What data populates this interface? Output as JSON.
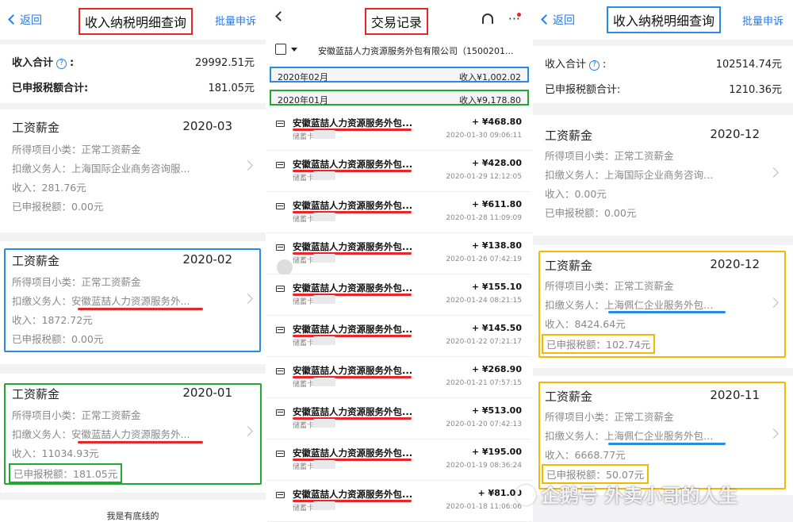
{
  "colors": {
    "accent": "#2a7ae2",
    "red_highlight": "#e8262a",
    "blue_highlight": "#2a8ae2",
    "green_highlight": "#22a832",
    "yellow_highlight": "#f5b800"
  },
  "left": {
    "nav": {
      "back": "返回",
      "title": "收入纳税明细查询",
      "right": "批量申诉"
    },
    "summary": {
      "income_label": "收入合计",
      "income_value": "29992.51元",
      "tax_label": "已申报税额合计:",
      "tax_value": "181.05元",
      "colon": ":"
    },
    "cards": [
      {
        "title": "工资薪金",
        "date": "2020-03",
        "subtype": "所得项目小类：正常工资薪金",
        "withholder": "扣缴义务人：上海国际企业商务咨询服...",
        "income": "收入：281.76元",
        "tax": "已申报税额：0.00元"
      },
      {
        "title": "工资薪金",
        "date": "2020-02",
        "subtype": "所得项目小类：正常工资薪金",
        "withholder_label": "扣缴义务人：",
        "withholder": "安徽蓝喆人力资源服务外...",
        "income": "收入：1872.72元",
        "tax": "已申报税额：0.00元"
      },
      {
        "title": "工资薪金",
        "date": "2020-01",
        "subtype": "所得项目小类：正常工资薪金",
        "withholder_label": "扣缴义务人：",
        "withholder": "安徽蓝喆人力资源服务外...",
        "income": "收入：11034.93元",
        "tax": "已申报税额：181.05元"
      }
    ],
    "footer": "我是有底线的"
  },
  "middle": {
    "nav": {
      "title": "交易记录"
    },
    "filter": {
      "merchant": "安徽蓝喆人力资源服务外包有限公司（1500201..."
    },
    "months": [
      {
        "month": "2020年02月",
        "summary": "收入¥1,002.02"
      },
      {
        "month": "2020年01月",
        "summary": "收入¥9,178.80"
      }
    ],
    "transactions": [
      {
        "name": "安徽蓝喆人力资源服务外包...",
        "card": "储蓄卡",
        "amount": "+ ¥468.80",
        "time": "2020-01-30 09:06:11"
      },
      {
        "name": "安徽蓝喆人力资源服务外包...",
        "card": "储蓄卡",
        "amount": "+ ¥428.00",
        "time": "2020-01-29 12:12:05"
      },
      {
        "name": "安徽蓝喆人力资源服务外包...",
        "card": "储蓄卡",
        "amount": "+ ¥611.80",
        "time": "2020-01-28 11:09:09"
      },
      {
        "name": "安徽蓝喆人力资源服务外包...",
        "card": "储蓄卡",
        "amount": "+ ¥138.80",
        "time": "2020-01-26 07:42:19"
      },
      {
        "name": "安徽蓝喆人力资源服务外包...",
        "card": "储蓄卡",
        "amount": "+ ¥155.10",
        "time": "2020-01-24 08:21:15"
      },
      {
        "name": "安徽蓝喆人力资源服务外包...",
        "card": "储蓄卡",
        "amount": "+ ¥145.50",
        "time": "2020-01-22 07:21:17"
      },
      {
        "name": "安徽蓝喆人力资源服务外包...",
        "card": "储蓄卡",
        "amount": "+ ¥268.90",
        "time": "2020-01-21 07:57:15"
      },
      {
        "name": "安徽蓝喆人力资源服务外包...",
        "card": "储蓄卡",
        "amount": "+ ¥513.00",
        "time": "2020-01-20 07:42:13"
      },
      {
        "name": "安徽蓝喆人力资源服务外包...",
        "card": "储蓄卡",
        "amount": "+ ¥195.00",
        "time": "2020-01-19 08:36:24"
      },
      {
        "name": "安徽蓝喆人力资源服务外包...",
        "card": "储蓄卡",
        "amount": "+ ¥81.00",
        "time": "2020-01-18 11:06:06"
      }
    ]
  },
  "right": {
    "nav": {
      "back": "返回",
      "title": "收入纳税明细查询",
      "right": "批量申诉"
    },
    "summary": {
      "income_label": "收入合计",
      "income_value": "102514.74元",
      "tax_label": "已申报税额合计:",
      "tax_value": "1210.36元",
      "colon": ":"
    },
    "cards": [
      {
        "title": "工资薪金",
        "date": "2020-12",
        "subtype": "所得项目小类：正常工资薪金",
        "withholder": "扣缴义务人：上海国际企业商务咨询…",
        "income": "收入：0.00元",
        "tax": "已申报税额：0.00元"
      },
      {
        "title": "工资薪金",
        "date": "2020-12",
        "subtype": "所得项目小类：正常工资薪金",
        "withholder_label": "扣缴义务人：",
        "withholder": "上海佩仁企业服务外包…",
        "income": "收入：8424.64元",
        "tax": "已申报税额：102.74元"
      },
      {
        "title": "工资薪金",
        "date": "2020-11",
        "subtype": "所得项目小类：正常工资薪金",
        "withholder_label": "扣缴义务人：",
        "withholder": "上海佩仁企业服务外包…",
        "income": "收入：6668.77元",
        "tax": "已申报税额：50.07元"
      }
    ]
  },
  "watermark": "企鹅号 外卖小哥的人生"
}
